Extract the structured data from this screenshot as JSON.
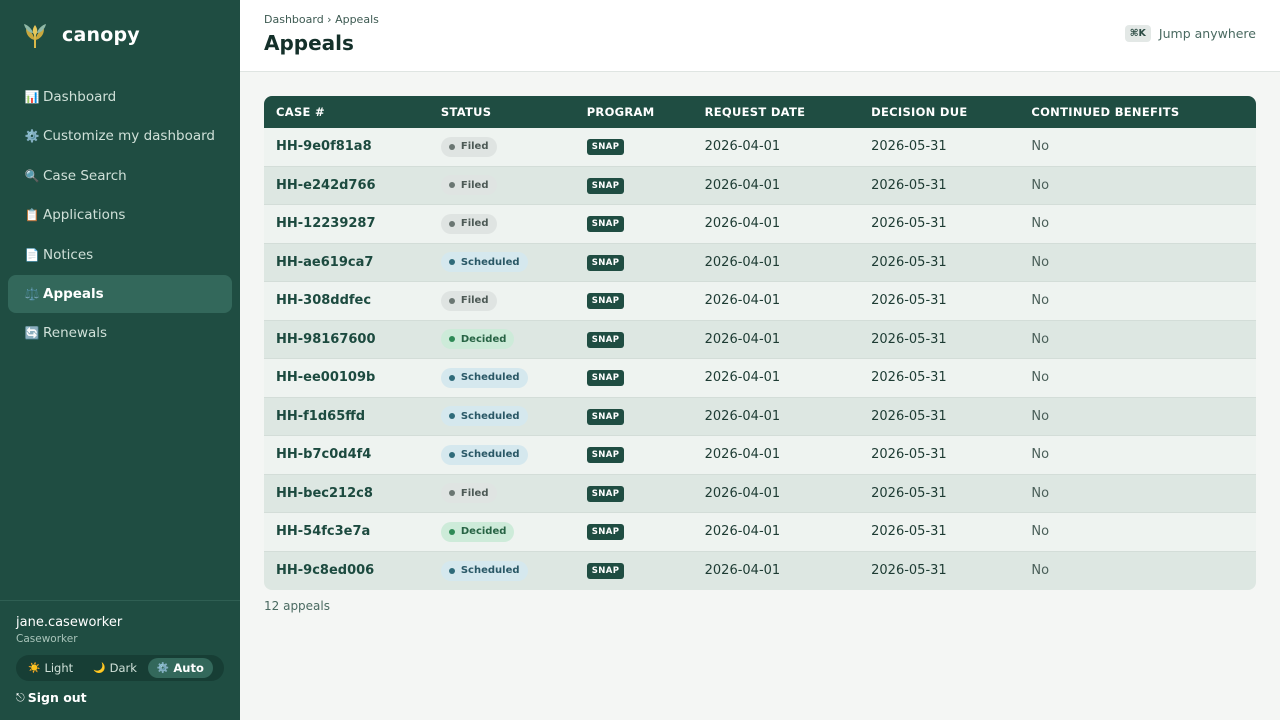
{
  "brand": {
    "name": "canopy"
  },
  "sidebar": {
    "items": [
      {
        "icon": "📊",
        "label": "Dashboard",
        "active": false
      },
      {
        "icon": "⚙️",
        "label": "Customize my dashboard",
        "active": false
      },
      {
        "icon": "🔍",
        "label": "Case Search",
        "active": false
      },
      {
        "icon": "📋",
        "label": "Applications",
        "active": false
      },
      {
        "icon": "📄",
        "label": "Notices",
        "active": false
      },
      {
        "icon": "⚖️",
        "label": "Appeals",
        "active": true
      },
      {
        "icon": "🔄",
        "label": "Renewals",
        "active": false
      }
    ],
    "user": {
      "name": "jane.caseworker",
      "role": "Caseworker"
    },
    "theme": {
      "options": [
        {
          "icon": "☀️",
          "label": "Light"
        },
        {
          "icon": "🌙",
          "label": "Dark"
        },
        {
          "icon": "⚙️",
          "label": "Auto"
        }
      ],
      "selected": "Auto"
    },
    "signout": {
      "icon": "⎋",
      "label": "Sign out"
    }
  },
  "header": {
    "breadcrumb": "Dashboard › Appeals",
    "title": "Appeals",
    "shortcut": "⌘K",
    "jump_label": "Jump anywhere"
  },
  "table": {
    "columns": [
      "CASE #",
      "STATUS",
      "PROGRAM",
      "REQUEST DATE",
      "DECISION DUE",
      "CONTINUED BENEFITS"
    ],
    "rows": [
      {
        "case": "HH-9e0f81a8",
        "status": "Filed",
        "program": "SNAP",
        "request_date": "2026-04-01",
        "decision_due": "2026-05-31",
        "continued": "No"
      },
      {
        "case": "HH-e242d766",
        "status": "Filed",
        "program": "SNAP",
        "request_date": "2026-04-01",
        "decision_due": "2026-05-31",
        "continued": "No"
      },
      {
        "case": "HH-12239287",
        "status": "Filed",
        "program": "SNAP",
        "request_date": "2026-04-01",
        "decision_due": "2026-05-31",
        "continued": "No"
      },
      {
        "case": "HH-ae619ca7",
        "status": "Scheduled",
        "program": "SNAP",
        "request_date": "2026-04-01",
        "decision_due": "2026-05-31",
        "continued": "No"
      },
      {
        "case": "HH-308ddfec",
        "status": "Filed",
        "program": "SNAP",
        "request_date": "2026-04-01",
        "decision_due": "2026-05-31",
        "continued": "No"
      },
      {
        "case": "HH-98167600",
        "status": "Decided",
        "program": "SNAP",
        "request_date": "2026-04-01",
        "decision_due": "2026-05-31",
        "continued": "No"
      },
      {
        "case": "HH-ee00109b",
        "status": "Scheduled",
        "program": "SNAP",
        "request_date": "2026-04-01",
        "decision_due": "2026-05-31",
        "continued": "No"
      },
      {
        "case": "HH-f1d65ffd",
        "status": "Scheduled",
        "program": "SNAP",
        "request_date": "2026-04-01",
        "decision_due": "2026-05-31",
        "continued": "No"
      },
      {
        "case": "HH-b7c0d4f4",
        "status": "Scheduled",
        "program": "SNAP",
        "request_date": "2026-04-01",
        "decision_due": "2026-05-31",
        "continued": "No"
      },
      {
        "case": "HH-bec212c8",
        "status": "Filed",
        "program": "SNAP",
        "request_date": "2026-04-01",
        "decision_due": "2026-05-31",
        "continued": "No"
      },
      {
        "case": "HH-54fc3e7a",
        "status": "Decided",
        "program": "SNAP",
        "request_date": "2026-04-01",
        "decision_due": "2026-05-31",
        "continued": "No"
      },
      {
        "case": "HH-9c8ed006",
        "status": "Scheduled",
        "program": "SNAP",
        "request_date": "2026-04-01",
        "decision_due": "2026-05-31",
        "continued": "No"
      }
    ]
  },
  "footer": {
    "count_label": "12 appeals"
  },
  "colors": {
    "sidebar_bg": "#1f4d42",
    "accent": "#1f4d42",
    "status_filed": "#dfe4e2",
    "status_scheduled": "#d5e8ee",
    "status_decided": "#cdebd9"
  }
}
